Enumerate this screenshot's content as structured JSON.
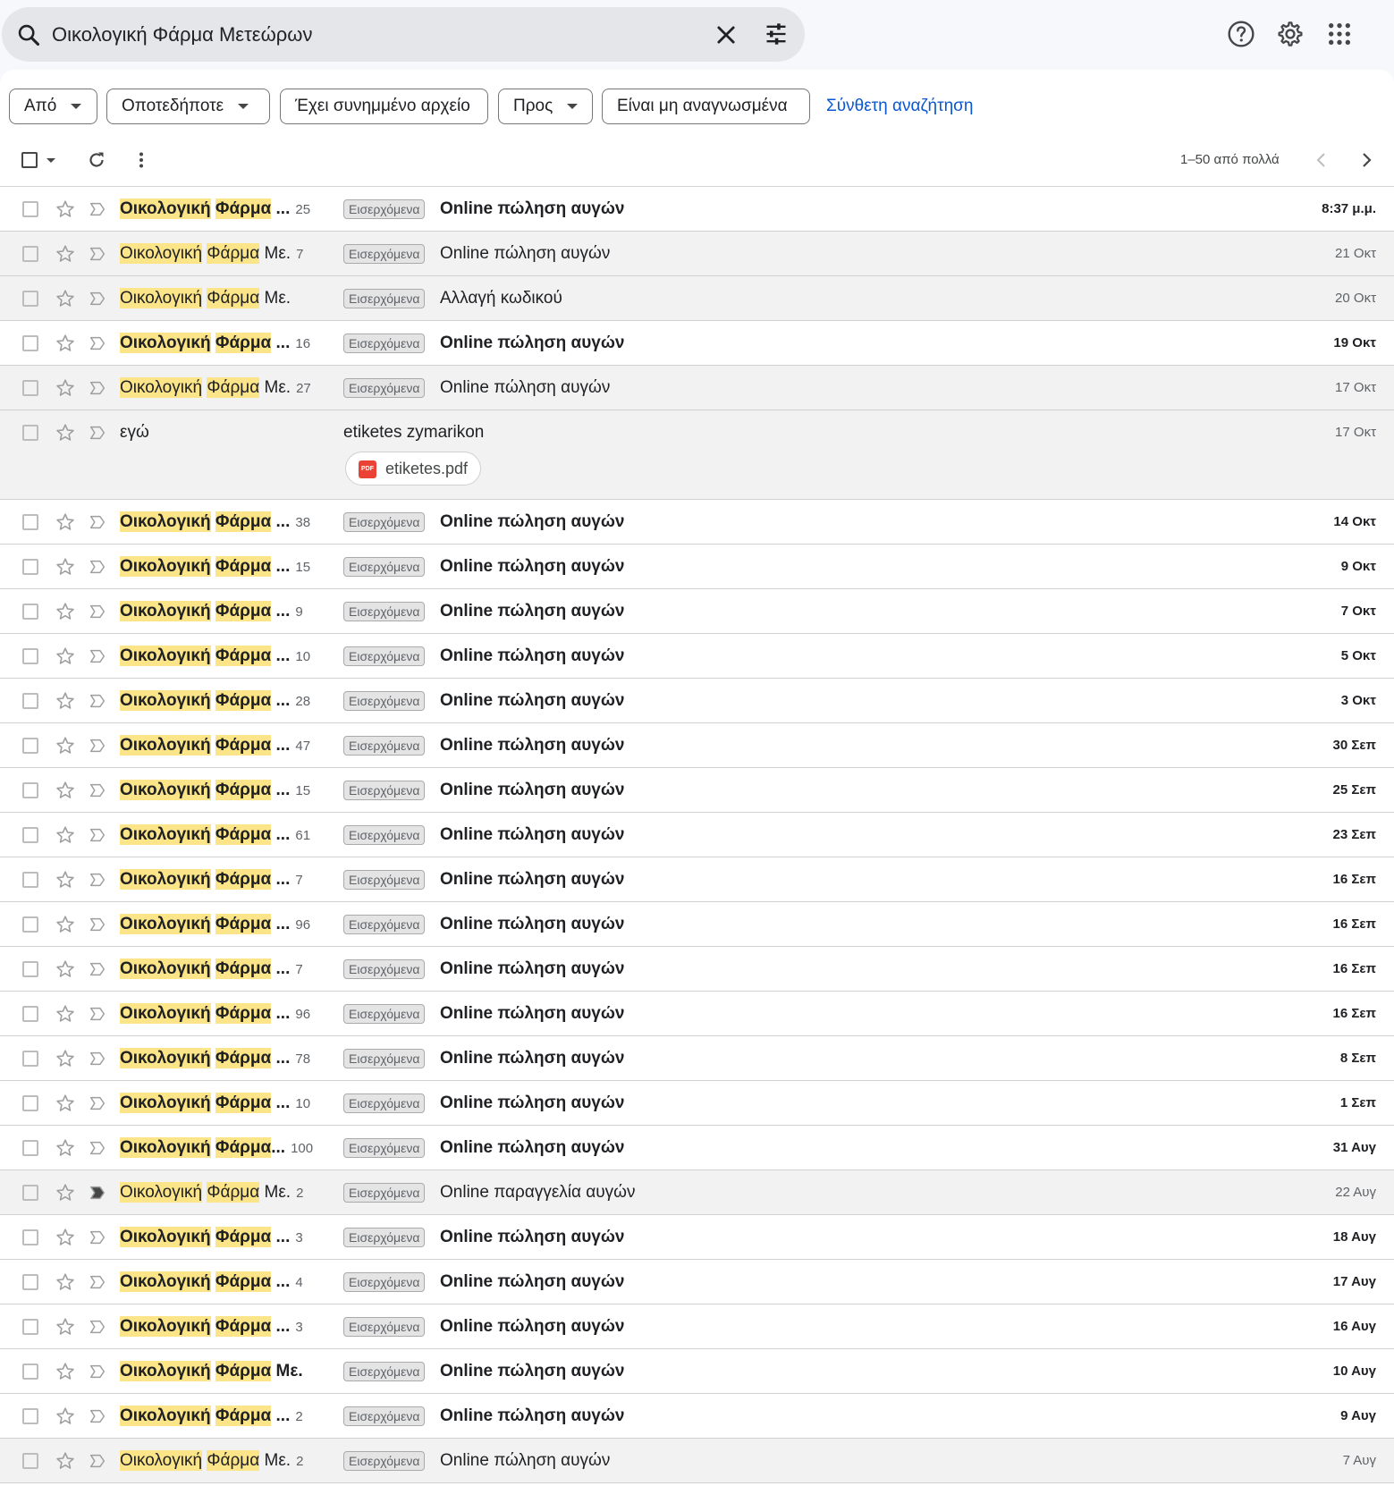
{
  "search": {
    "query": "Οικολογική Φάρμα Μετεώρων"
  },
  "filters": {
    "from": "Από",
    "any_time": "Οποτεδήποτε",
    "has_attachment": "Έχει συνημμένο αρχείο",
    "to": "Προς",
    "unread": "Είναι μη αναγνωσμένα",
    "advanced": "Σύνθετη αναζήτηση"
  },
  "pager": {
    "text": "1–50 από πολλά"
  },
  "sender_parts": {
    "h1": "Οικολογική",
    "h2": "Φάρμα"
  },
  "label_inbox": "Εισερχόμενα",
  "emails": [
    {
      "tail": " ...",
      "count": "25",
      "subject": "Online πώληση αυγών",
      "date": "8:37 μ.μ.",
      "unread": true
    },
    {
      "tail": " Με.",
      "count": "7",
      "subject": "Online πώληση αυγών",
      "date": "21 Οκτ",
      "unread": false
    },
    {
      "tail": " Με.",
      "count": "",
      "subject": "Αλλαγή κωδικού",
      "date": "20 Οκτ",
      "unread": false
    },
    {
      "tail": " ...",
      "count": "16",
      "subject": "Online πώληση αυγών",
      "date": "19 Οκτ",
      "unread": true
    },
    {
      "tail": " Με.",
      "count": "27",
      "subject": "Online πώληση αυγών",
      "date": "17 Οκτ",
      "unread": false
    },
    {
      "sender_plain": "εγώ",
      "subject": "etiketes zymarikon",
      "date": "17 Οκτ",
      "attachment": "etiketes.pdf",
      "unread": false
    },
    {
      "tail": " ...",
      "count": "38",
      "subject": "Online πώληση αυγών",
      "date": "14 Οκτ",
      "unread": true
    },
    {
      "tail": " ...",
      "count": "15",
      "subject": "Online πώληση αυγών",
      "date": "9 Οκτ",
      "unread": true
    },
    {
      "tail": " ...",
      "count": "9",
      "subject": "Online πώληση αυγών",
      "date": "7 Οκτ",
      "unread": true
    },
    {
      "tail": " ...",
      "count": "10",
      "subject": "Online πώληση αυγών",
      "date": "5 Οκτ",
      "unread": true
    },
    {
      "tail": " ...",
      "count": "28",
      "subject": "Online πώληση αυγών",
      "date": "3 Οκτ",
      "unread": true
    },
    {
      "tail": " ...",
      "count": "47",
      "subject": "Online πώληση αυγών",
      "date": "30 Σεπ",
      "unread": true
    },
    {
      "tail": " ...",
      "count": "15",
      "subject": "Online πώληση αυγών",
      "date": "25 Σεπ",
      "unread": true
    },
    {
      "tail": " ...",
      "count": "61",
      "subject": "Online πώληση αυγών",
      "date": "23 Σεπ",
      "unread": true
    },
    {
      "tail": " ...",
      "count": "7",
      "subject": "Online πώληση αυγών",
      "date": "16 Σεπ",
      "unread": true
    },
    {
      "tail": " ...",
      "count": "96",
      "subject": "Online πώληση αυγών",
      "date": "16 Σεπ",
      "unread": true
    },
    {
      "tail": " ...",
      "count": "7",
      "subject": "Online πώληση αυγών",
      "date": "16 Σεπ",
      "unread": true
    },
    {
      "tail": " ...",
      "count": "96",
      "subject": "Online πώληση αυγών",
      "date": "16 Σεπ",
      "unread": true
    },
    {
      "tail": " ...",
      "count": "78",
      "subject": "Online πώληση αυγών",
      "date": "8 Σεπ",
      "unread": true
    },
    {
      "tail": " ...",
      "count": "10",
      "subject": "Online πώληση αυγών",
      "date": "1 Σεπ",
      "unread": true
    },
    {
      "tail": "...",
      "count": "100",
      "subject": "Online πώληση αυγών",
      "date": "31 Αυγ",
      "unread": true
    },
    {
      "tail": " Με.",
      "count": "2",
      "subject": "Online παραγγελία αυγών",
      "date": "22 Αυγ",
      "unread": false,
      "important": true
    },
    {
      "tail": " ...",
      "count": "3",
      "subject": "Online πώληση αυγών",
      "date": "18 Αυγ",
      "unread": true
    },
    {
      "tail": " ...",
      "count": "4",
      "subject": "Online πώληση αυγών",
      "date": "17 Αυγ",
      "unread": true
    },
    {
      "tail": " ...",
      "count": "3",
      "subject": "Online πώληση αυγών",
      "date": "16 Αυγ",
      "unread": true
    },
    {
      "tail": " Με.",
      "count": "",
      "subject": "Online πώληση αυγών",
      "date": "10 Αυγ",
      "unread": true
    },
    {
      "tail": " ...",
      "count": "2",
      "subject": "Online πώληση αυγών",
      "date": "9 Αυγ",
      "unread": true
    },
    {
      "tail": " Με.",
      "count": "2",
      "subject": "Online πώληση αυγών",
      "date": "7 Αυγ",
      "unread": false
    }
  ]
}
